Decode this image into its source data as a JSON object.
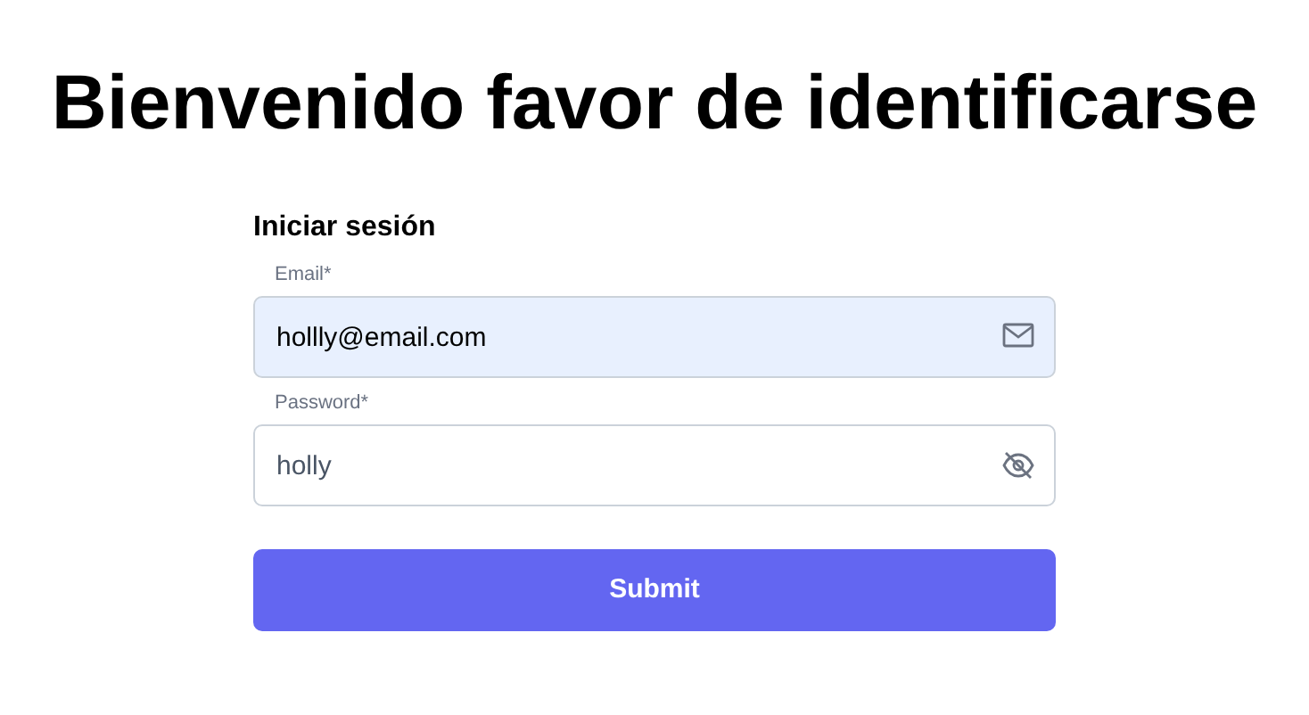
{
  "heading": "Bienvenido favor de identificarse",
  "form": {
    "title": "Iniciar sesión",
    "fields": [
      {
        "kind": "email",
        "label": "Email*",
        "value": "hollly@email.com",
        "autofilled": true
      },
      {
        "kind": "password",
        "label": "Password*",
        "value": "holly",
        "autofilled": false
      }
    ],
    "submit": "Submit"
  }
}
